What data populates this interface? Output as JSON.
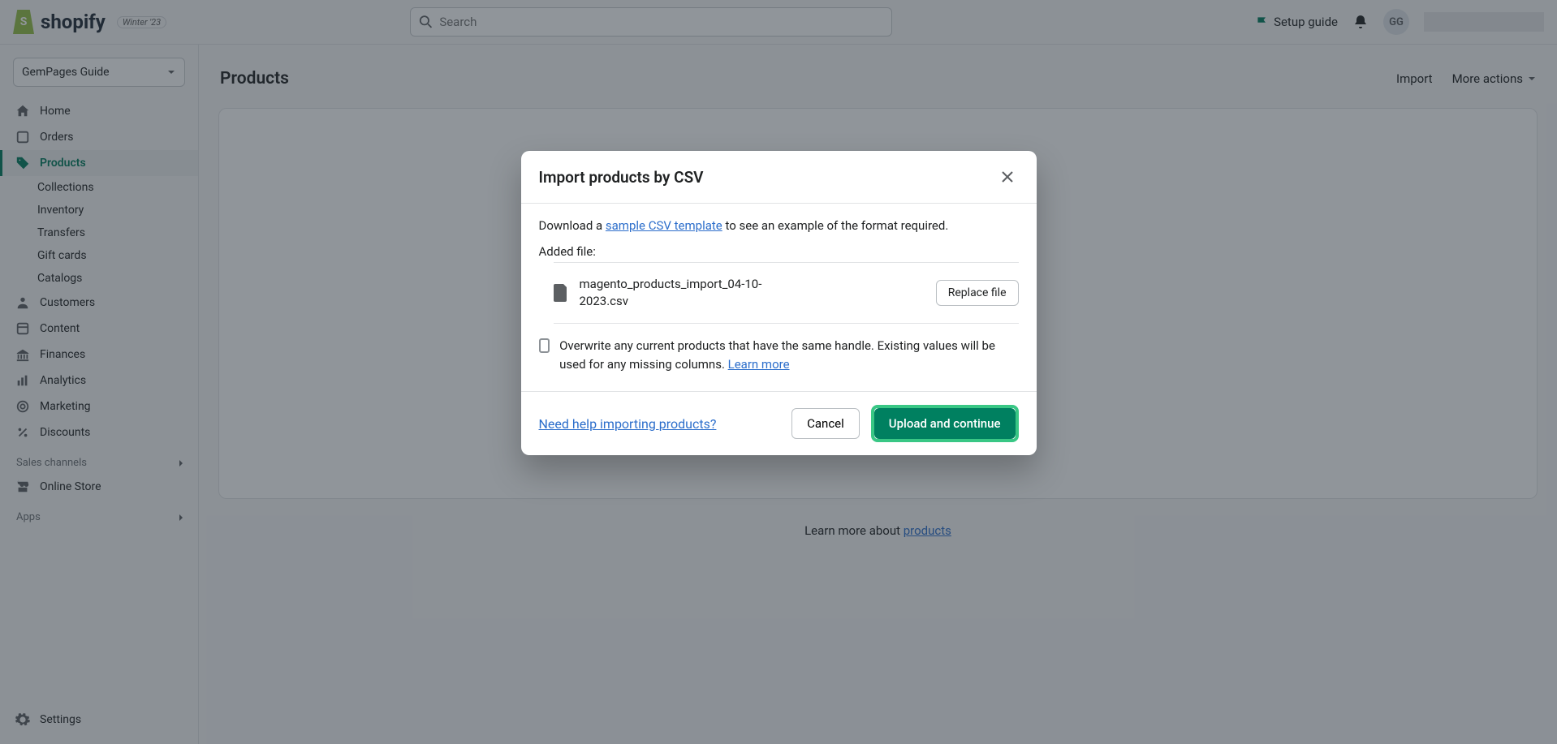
{
  "header": {
    "edition_badge": "Winter '23",
    "search_placeholder": "Search",
    "setup_guide": "Setup guide",
    "avatar_initials": "GG"
  },
  "sidebar": {
    "store_name": "GemPages Guide",
    "items": [
      {
        "label": "Home"
      },
      {
        "label": "Orders"
      },
      {
        "label": "Products"
      },
      {
        "label": "Customers"
      },
      {
        "label": "Content"
      },
      {
        "label": "Finances"
      },
      {
        "label": "Analytics"
      },
      {
        "label": "Marketing"
      },
      {
        "label": "Discounts"
      }
    ],
    "product_sub": [
      {
        "label": "Collections"
      },
      {
        "label": "Inventory"
      },
      {
        "label": "Transfers"
      },
      {
        "label": "Gift cards"
      },
      {
        "label": "Catalogs"
      }
    ],
    "sales_channels_title": "Sales channels",
    "online_store": "Online Store",
    "apps_title": "Apps",
    "settings": "Settings"
  },
  "page": {
    "title": "Products",
    "import_action": "Import",
    "more_actions": "More actions",
    "learn_prefix": "Learn more about ",
    "learn_link": "products"
  },
  "modal": {
    "title": "Import products by CSV",
    "download_prefix": "Download a ",
    "sample_link": "sample CSV template",
    "download_suffix": " to see an example of the format required.",
    "added_label": "Added file:",
    "file_name": "magento_products_import_04-10-2023.csv",
    "replace_btn": "Replace file",
    "overwrite_text_a": "Overwrite any current products that have the same handle. Existing values will be used for any missing columns. ",
    "learn_more": "Learn more",
    "help_link": "Need help importing products?",
    "cancel": "Cancel",
    "upload": "Upload and continue"
  }
}
